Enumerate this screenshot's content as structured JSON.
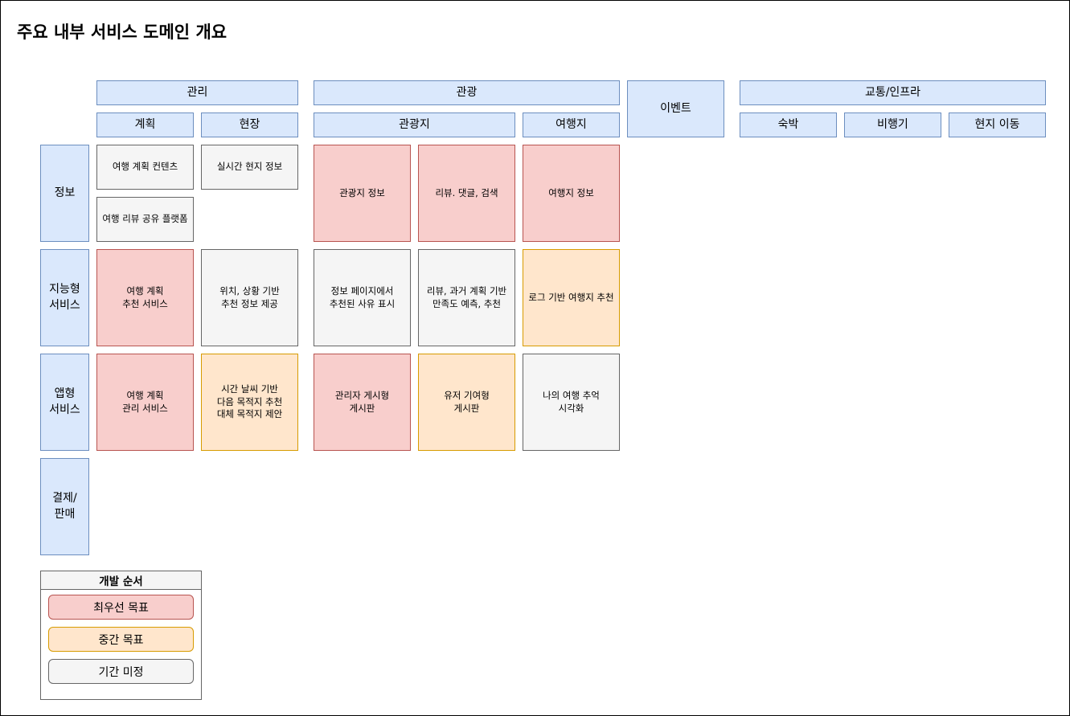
{
  "title": "주요 내부 서비스 도메인 개요",
  "colors": {
    "header": "#dae8fc",
    "priority": "#f8cecc",
    "mid": "#ffe6cc",
    "undecided": "#f5f5f5"
  },
  "groups": {
    "management": "관리",
    "tourism": "관광",
    "event": "이벤트",
    "transport": "교통/인프라"
  },
  "subgroups": {
    "plan": "계획",
    "field": "현장",
    "attraction": "관광지",
    "destination": "여행지",
    "lodging": "숙박",
    "flight": "비행기",
    "local_transport": "현지 이동"
  },
  "rows": {
    "info": "정보",
    "intelligent": "지능형\n서비스",
    "app": "앱형\n서비스",
    "payment": "결제/\n판매"
  },
  "cells": {
    "info_plan_content": "여행 계획 컨텐츠",
    "info_plan_review": "여행 리뷰 공유 플랫폼",
    "info_field": "실시간 현지 정보",
    "info_attraction": "관광지 정보",
    "info_review": "리뷰. 댓글, 검색",
    "info_destination": "여행지 정보",
    "intel_plan": "여행 계획\n추천 서비스",
    "intel_field": "위치, 상황 기반\n추천 정보 제공",
    "intel_attraction": "정보 페이지에서\n추천된 사유 표시",
    "intel_review": "리뷰, 과거 계획 기반\n만족도 예측, 추천",
    "intel_destination": "로그 기반 여행지 추천",
    "app_plan": "여행 계획\n관리 서비스",
    "app_field": "시간 날씨 기반\n다음 목적지 추천\n대체 목적지 제안",
    "app_attraction": "관리자 게시형\n게시판",
    "app_review": "유저 기여형\n게시판",
    "app_destination": "나의 여행 추억\n시각화"
  },
  "legend": {
    "title": "개발 순서",
    "priority": "최우선 목표",
    "mid": "중간 목표",
    "undecided": "기간 미정"
  }
}
